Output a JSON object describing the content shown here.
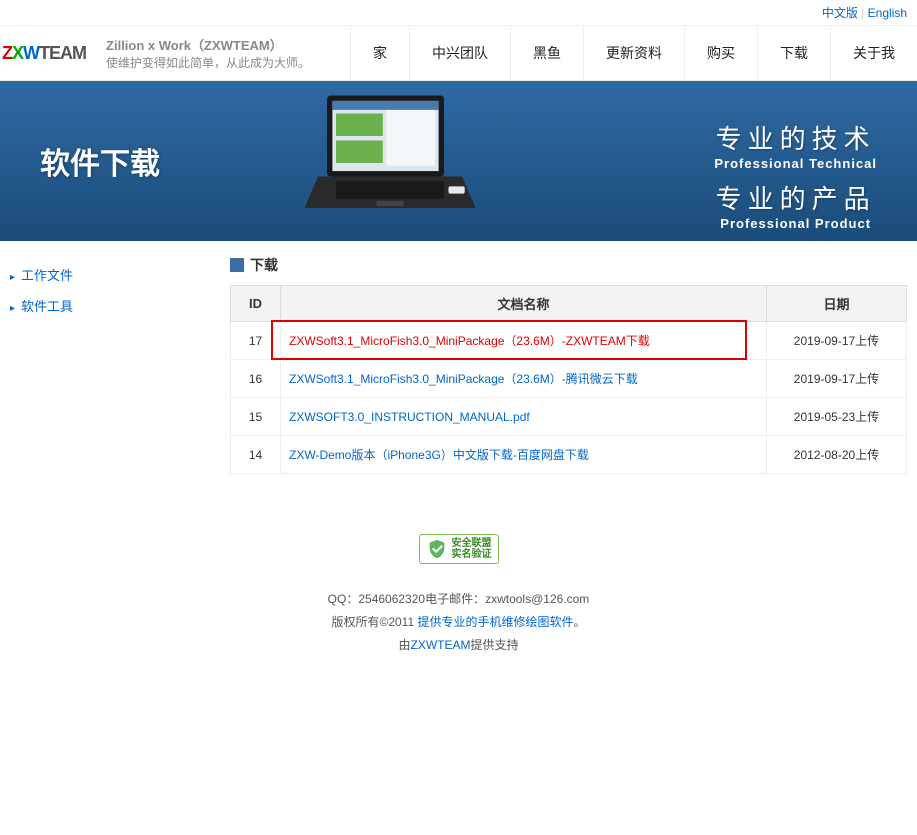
{
  "topbar": {
    "cn": "中文版",
    "sep": " | ",
    "en": "English"
  },
  "brand": {
    "logo_z": "Z",
    "logo_x": "X",
    "logo_w": "W",
    "logo_rest": "TEAM",
    "title_l1": "Zillion x Work（ZXWTEAM）",
    "title_l2": "使维护变得如此简单，从此成为大师。"
  },
  "nav": [
    "家",
    "中兴团队",
    "黑鱼",
    "更新资料",
    "购买",
    "下载",
    "关于我"
  ],
  "banner": {
    "title": "软件下载",
    "s1_cn": "专业的技术",
    "s1_en": "Professional Technical",
    "s2_cn": "专业的产品",
    "s2_en": "Professional Product"
  },
  "sidebar": [
    "工作文件",
    "软件工具"
  ],
  "section_title": "下载",
  "table": {
    "head": {
      "id": "ID",
      "name": "文档名称",
      "date": "日期"
    },
    "rows": [
      {
        "id": "17",
        "name": "ZXWSoft3.1_MicroFish3.0_MiniPackage（23.6M）-ZXWTEAM下载",
        "date": "2019-09-17上传",
        "highlight": true
      },
      {
        "id": "16",
        "name": "ZXWSoft3.1_MicroFish3.0_MiniPackage（23.6M）-腾讯微云下载",
        "date": "2019-09-17上传"
      },
      {
        "id": "15",
        "name": "ZXWSOFT3.0_INSTRUCTION_MANUAL.pdf",
        "date": "2019-05-23上传"
      },
      {
        "id": "14",
        "name": "ZXW-Demo版本（iPhone3G）中文版下载-百度网盘下载",
        "date": "2012-08-20上传"
      }
    ]
  },
  "footer": {
    "badge_l1": "安全联盟",
    "badge_l2": "实名验证",
    "contact": "QQ：2546062320电子邮件：zxwtools@126.com",
    "copy_pre": "版权所有©2011 ",
    "copy_link": "提供专业的手机维修绘图软件",
    "copy_post": "。",
    "by_pre": "由",
    "by_link": "ZXWTEAM",
    "by_post": "提供支持"
  }
}
